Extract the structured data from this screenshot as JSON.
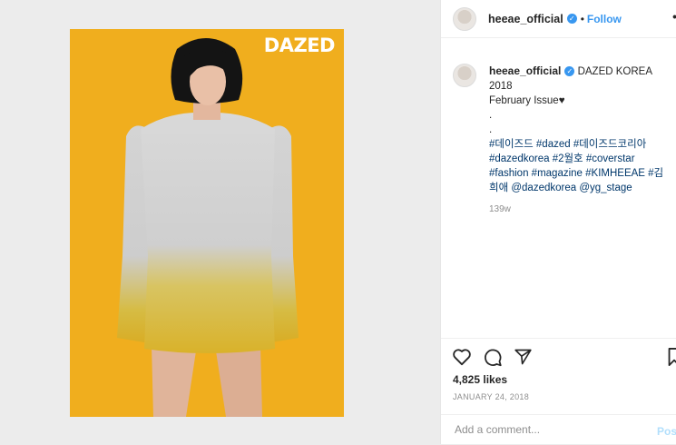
{
  "post": {
    "image_brand": "DAZED",
    "brand_color": "#ffffff",
    "background_color": "#f0ae1e"
  },
  "header": {
    "username": "heeae_official",
    "verified_icon": "verified-badge-icon",
    "separator": "•",
    "follow_label": "Follow",
    "more_label": "•"
  },
  "caption": {
    "username": "heeae_official",
    "text_line1": "DAZED KOREA 2018",
    "text_line2": "February Issue♥",
    "dot1": ".",
    "dot2": ".",
    "tags_line1": "#데이즈드 #dazed #데이즈드코리아",
    "tags_line2": "#dazedkorea #2월호 #coverstar",
    "tags_line3": "#fashion #magazine #KIMHEEAE #김",
    "tags_line4": "희애 @dazedkorea @yg_stage",
    "time_ago": "139w"
  },
  "actions": {
    "like_icon": "heart-icon",
    "comment_icon": "comment-icon",
    "share_icon": "share-icon",
    "save_icon": "bookmark-icon"
  },
  "likes_text": "4,825 likes",
  "date_text": "JANUARY 24, 2018",
  "comment": {
    "placeholder": "Add a comment...",
    "post_label": "Pos"
  },
  "colors": {
    "link_blue": "#3897f0",
    "hashtag": "#00376b",
    "muted": "#8e8e8e"
  }
}
